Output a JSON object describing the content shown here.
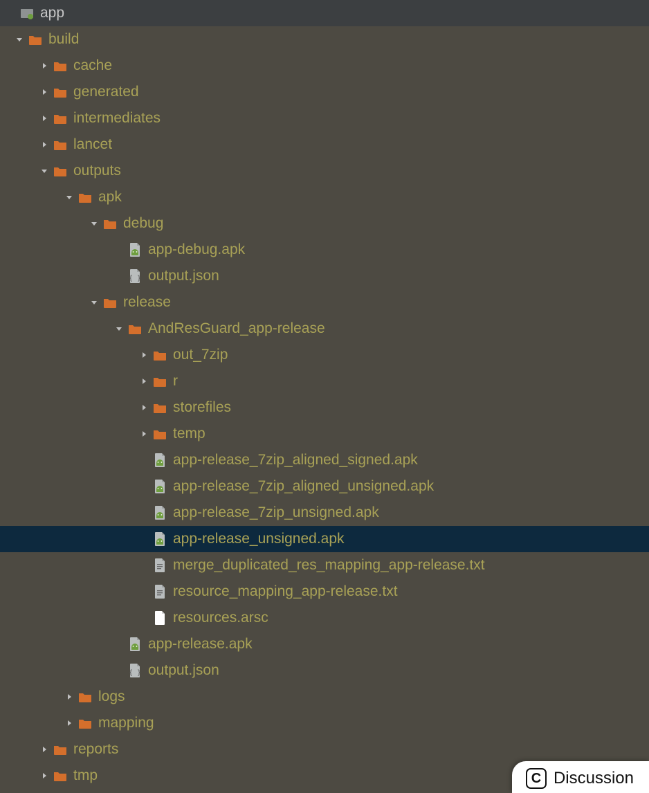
{
  "nodes": [
    {
      "depth": 0,
      "arrow": "none",
      "icon": "module",
      "label": "app",
      "labelClass": "grey",
      "rowClass": "root"
    },
    {
      "depth": 0,
      "arrow": "down",
      "icon": "folder",
      "label": "build"
    },
    {
      "depth": 1,
      "arrow": "right",
      "icon": "folder",
      "label": "cache"
    },
    {
      "depth": 1,
      "arrow": "right",
      "icon": "folder",
      "label": "generated"
    },
    {
      "depth": 1,
      "arrow": "right",
      "icon": "folder",
      "label": "intermediates"
    },
    {
      "depth": 1,
      "arrow": "right",
      "icon": "folder",
      "label": "lancet"
    },
    {
      "depth": 1,
      "arrow": "down",
      "icon": "folder",
      "label": "outputs"
    },
    {
      "depth": 2,
      "arrow": "down",
      "icon": "folder",
      "label": "apk"
    },
    {
      "depth": 3,
      "arrow": "down",
      "icon": "folder",
      "label": "debug"
    },
    {
      "depth": 4,
      "arrow": "none",
      "icon": "apk",
      "label": "app-debug.apk"
    },
    {
      "depth": 4,
      "arrow": "none",
      "icon": "json",
      "label": "output.json"
    },
    {
      "depth": 3,
      "arrow": "down",
      "icon": "folder",
      "label": "release"
    },
    {
      "depth": 4,
      "arrow": "down",
      "icon": "folder",
      "label": "AndResGuard_app-release"
    },
    {
      "depth": 5,
      "arrow": "right",
      "icon": "folder",
      "label": "out_7zip"
    },
    {
      "depth": 5,
      "arrow": "right",
      "icon": "folder",
      "label": "r"
    },
    {
      "depth": 5,
      "arrow": "right",
      "icon": "folder",
      "label": "storefiles"
    },
    {
      "depth": 5,
      "arrow": "right",
      "icon": "folder",
      "label": "temp"
    },
    {
      "depth": 5,
      "arrow": "none",
      "icon": "apk",
      "label": "app-release_7zip_aligned_signed.apk"
    },
    {
      "depth": 5,
      "arrow": "none",
      "icon": "apk",
      "label": "app-release_7zip_aligned_unsigned.apk"
    },
    {
      "depth": 5,
      "arrow": "none",
      "icon": "apk",
      "label": "app-release_7zip_unsigned.apk"
    },
    {
      "depth": 5,
      "arrow": "none",
      "icon": "apk",
      "label": "app-release_unsigned.apk",
      "rowClass": "selected"
    },
    {
      "depth": 5,
      "arrow": "none",
      "icon": "txt",
      "label": "merge_duplicated_res_mapping_app-release.txt"
    },
    {
      "depth": 5,
      "arrow": "none",
      "icon": "txt",
      "label": "resource_mapping_app-release.txt"
    },
    {
      "depth": 5,
      "arrow": "none",
      "icon": "file",
      "label": "resources.arsc"
    },
    {
      "depth": 4,
      "arrow": "none",
      "icon": "apk",
      "label": "app-release.apk"
    },
    {
      "depth": 4,
      "arrow": "none",
      "icon": "json",
      "label": "output.json"
    },
    {
      "depth": 2,
      "arrow": "right",
      "icon": "folder",
      "label": "logs"
    },
    {
      "depth": 2,
      "arrow": "right",
      "icon": "folder",
      "label": "mapping"
    },
    {
      "depth": 1,
      "arrow": "right",
      "icon": "folder",
      "label": "reports"
    },
    {
      "depth": 1,
      "arrow": "right",
      "icon": "folder",
      "label": "tmp"
    }
  ],
  "discussion": {
    "label": "Discussion",
    "badge": "C"
  },
  "colors": {
    "folder": "#d46f2c",
    "label": "#a8a156",
    "selected_bg": "#0d293e",
    "root_bg": "#3c3f41"
  }
}
